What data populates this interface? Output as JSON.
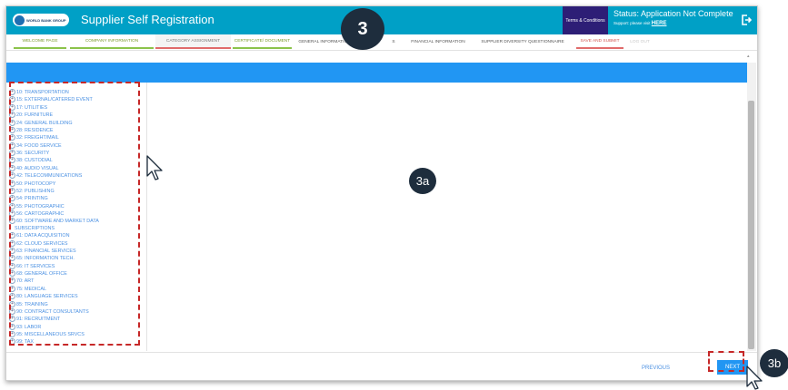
{
  "header": {
    "logo_text": "WORLD BANK GROUP",
    "app_title": "Supplier Self Registration",
    "terms_label": "Terms & Conditions",
    "status_text": "Status: Application Not Complete",
    "support_prefix": "Support: please visit ",
    "support_link": "HERE",
    "header_color": "#00a0c6",
    "terms_color": "#2d1e76"
  },
  "tabs": [
    {
      "label": "WELCOME PAGE",
      "state": "done"
    },
    {
      "label": "COMPANY INFORMATION",
      "state": "done"
    },
    {
      "label": "CATEGORY ASSIGNMENT",
      "state": "current"
    },
    {
      "label": "CERTIFICATE/ DOCUMENT",
      "state": "done"
    },
    {
      "label": "GENERAL INFORMATION",
      "state": "normal"
    },
    {
      "label": "S",
      "state": "normal"
    },
    {
      "label": "FINANCIAL INFORMATION",
      "state": "normal"
    },
    {
      "label": "SUPPLIER DIVERSITY QUESTIONNAIRE",
      "state": "normal"
    },
    {
      "label": "SAVE AND SUBMIT",
      "state": "save"
    },
    {
      "label": "LOG OUT",
      "state": "disabled"
    }
  ],
  "categories": [
    "10: TRANSPORTATION",
    "15: EXTERNAL/CATERED EVENT",
    "17: UTILITIES",
    "20: FURNITURE",
    "24: GENERAL BUILDING",
    "28: RESIDENCE",
    "32: FREIGHT/MAIL",
    "34: FOOD SERVICE",
    "36: SECURITY",
    "38: CUSTODIAL",
    "40: AUDIO VISUAL",
    "42: TELECOMMUNICATIONS",
    "50: PHOTOCOPY",
    "52: PUBLISHING",
    "54: PRINTING",
    "55: PHOTOGRAPHIC",
    "56: CARTOGRAPHIC",
    "60: SOFTWARE AND MARKET DATA",
    "SUBSCRIPTIONS",
    "61: DATA ACQUISITION",
    "62: CLOUD SERVICES",
    "63: FINANCIAL SERVICES",
    "65: INFORMATION TECH.",
    "66: IT SERVICES",
    "68: GENERAL OFFICE",
    "70: ART",
    "75: MEDICAL",
    "80: LANGUAGE SERVICES",
    "85: TRAINING",
    "90: CONTRACT CONSULTANTS",
    "91: RECRUITMENT",
    "93: LABOR",
    "95: MISCELLANEOUS SRVCS",
    "99: TAX"
  ],
  "footer": {
    "previous_label": "PREVIOUS",
    "next_label": "NEXT"
  },
  "annotations": {
    "step": "3",
    "list_marker": "3a",
    "next_marker": "3b"
  }
}
